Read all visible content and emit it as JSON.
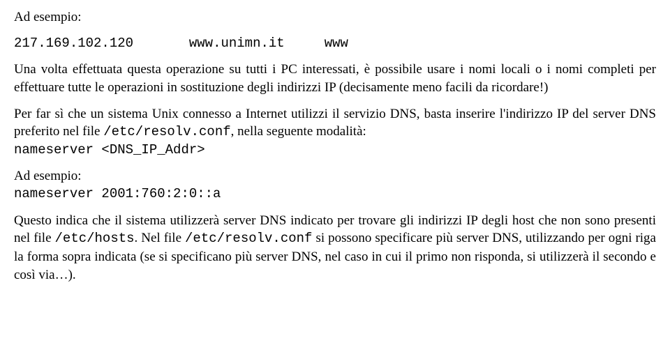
{
  "heading1": "Ad esempio:",
  "hostentry": {
    "ip": "217.169.102.120",
    "spacer": "       ",
    "hosts": "www.unimn.it     www"
  },
  "para1": "Una volta effettuata questa operazione su tutti i PC interessati, è possibile usare i nomi locali o i nomi completi per effettuare tutte le operazioni in sostituzione degli indirizzi IP (decisamente meno facili da ricordare!)",
  "para2_part1": "Per far sì che un sistema Unix connesso a Internet utilizzi il servizio DNS, basta inserire l'indirizzo IP del server DNS preferito nel file ",
  "para2_code1": "/etc/resolv.conf",
  "para2_part2": ", nella seguente modalità:",
  "nameserver_line": "nameserver <DNS_IP_Addr>",
  "heading2": "Ad esempio:",
  "nameserver_example": "nameserver 2001:760:2:0::a",
  "para3_part1": "Questo indica che il sistema utilizzerà server DNS indicato per trovare gli indirizzi IP degli host che non sono presenti nel file ",
  "para3_code1": "/etc/hosts",
  "para3_part2": ". Nel file ",
  "para3_code2": "/etc/resolv.conf",
  "para3_part3": " si possono specificare più server DNS, utilizzando per ogni riga la forma sopra indicata (se si specificano più server DNS, nel caso in cui il primo non risponda, si utilizzerà il secondo e così via…)."
}
